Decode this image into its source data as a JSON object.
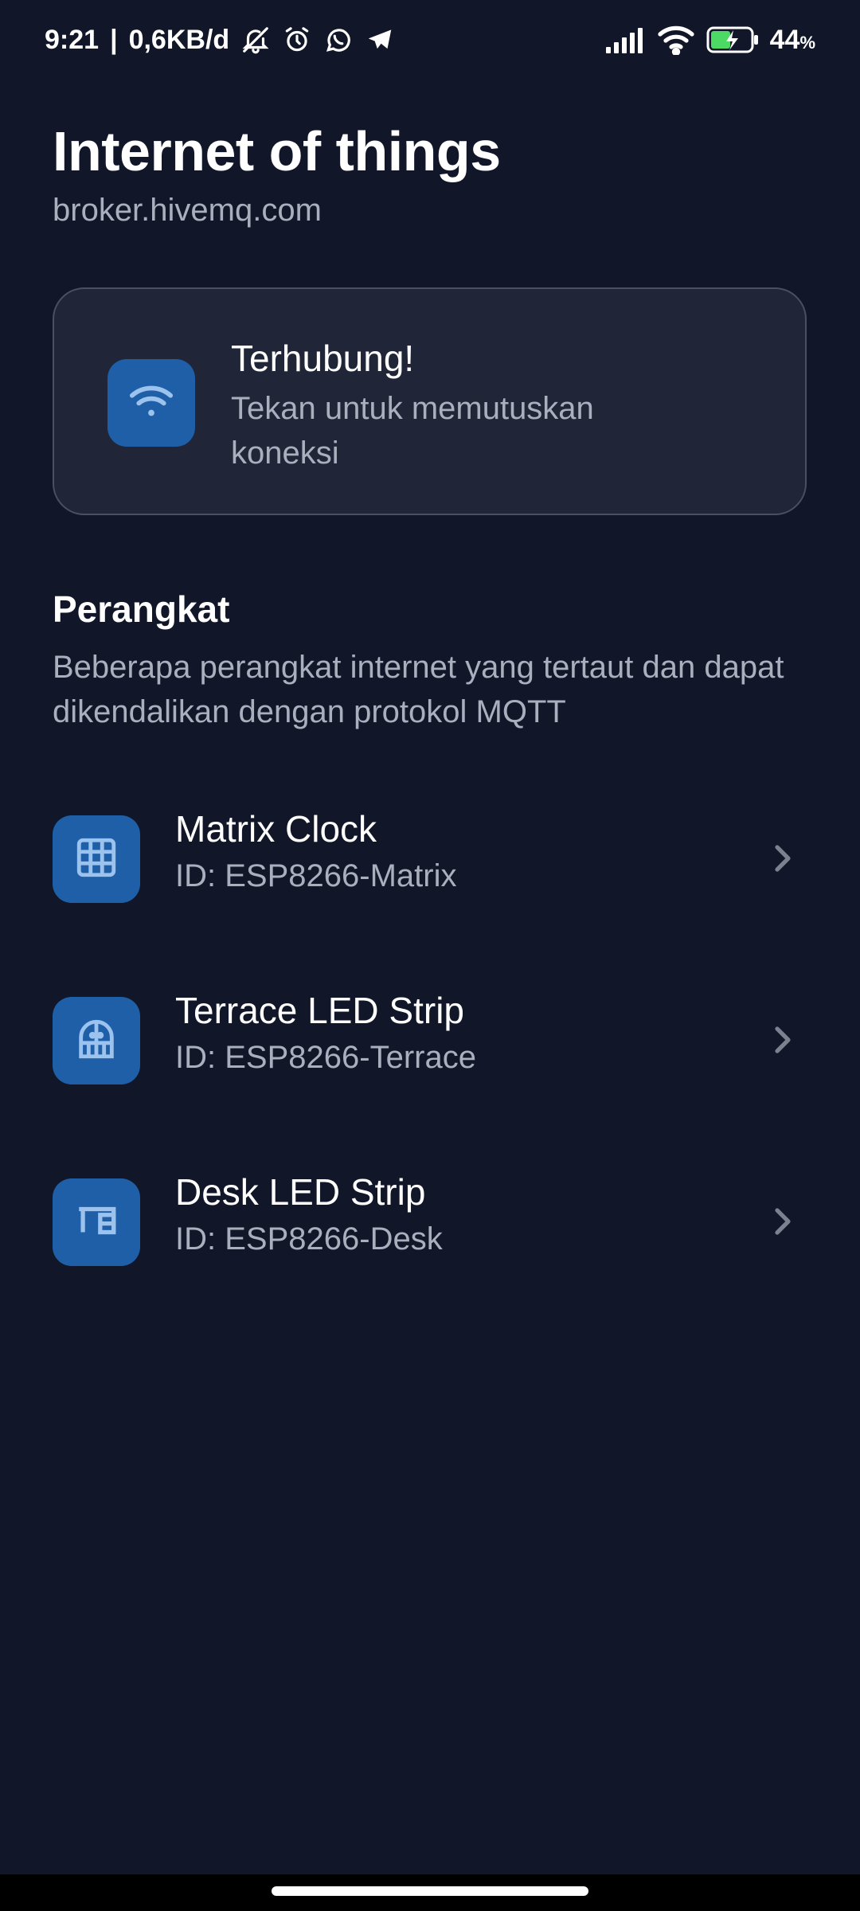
{
  "status_bar": {
    "time": "9:21",
    "separator": "|",
    "network_speed": "0,6KB/d",
    "battery_percent": "44",
    "battery_unit": "%",
    "icons": [
      "bell-off-icon",
      "alarm-icon",
      "whatsapp-icon",
      "telegram-icon",
      "signal-icon",
      "wifi-icon",
      "battery-charging-icon"
    ]
  },
  "header": {
    "title": "Internet of things",
    "subtitle": "broker.hivemq.com"
  },
  "connection": {
    "title": "Terhubung!",
    "description": "Tekan untuk memutuskan koneksi",
    "icon": "wifi-icon"
  },
  "section": {
    "title": "Perangkat",
    "description": "Beberapa perangkat internet yang tertaut dan dapat dikendalikan dengan protokol MQTT"
  },
  "devices": [
    {
      "name": "Matrix Clock",
      "id": "ID: ESP8266-Matrix",
      "icon": "grid-icon"
    },
    {
      "name": "Terrace LED Strip",
      "id": "ID: ESP8266-Terrace",
      "icon": "door-icon"
    },
    {
      "name": "Desk LED Strip",
      "id": "ID: ESP8266-Desk",
      "icon": "desk-icon"
    }
  ],
  "colors": {
    "background": "#111728",
    "card": "#202637",
    "accent": "#1e5fa8",
    "icon_light": "#9cc3ee",
    "muted_text": "#a9afbd"
  }
}
